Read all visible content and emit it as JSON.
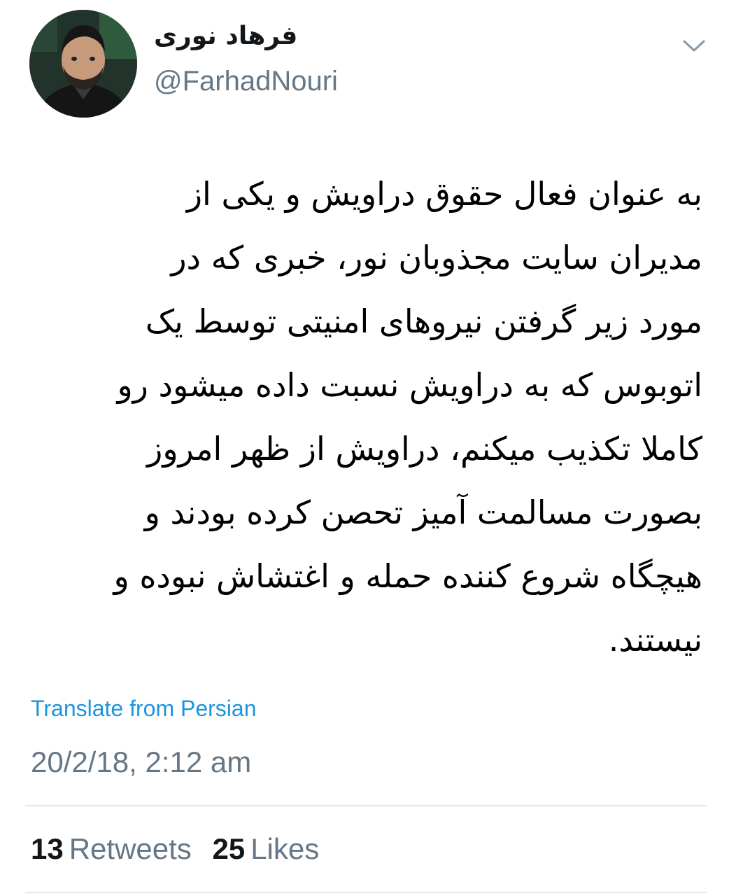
{
  "author": {
    "display_name": "فرهاد نوری",
    "handle": "@FarhadNouri"
  },
  "tweet": {
    "lines": [
      "به عنوان فعال حقوق دراویش و یکی از",
      "مدیران سایت مجذوبان نور، خبری که در",
      "مورد زیر گرفتن نیروهای امنیتی توسط یک",
      "اتوبوس که به دراویش نسبت داده میشود رو",
      "کاملا تکذیب میکنم، دراویش از ظهر امروز",
      "بصورت مسالمت آمیز تحصن کرده بودند و",
      "هیچگاه شروع کننده حمله و اغتشاش نبوده و",
      "نیستند."
    ],
    "translate_label": "Translate from Persian",
    "timestamp": "20/2/18, 2:12 am"
  },
  "stats": {
    "retweets_count": "13",
    "retweets_label": "Retweets",
    "likes_count": "25",
    "likes_label": "Likes"
  },
  "icons": {
    "menu": "chevron-down-icon"
  },
  "colors": {
    "link": "#1b95e0",
    "secondary_text": "#657786",
    "primary_text": "#14171a",
    "divider": "#e1e8ed"
  }
}
